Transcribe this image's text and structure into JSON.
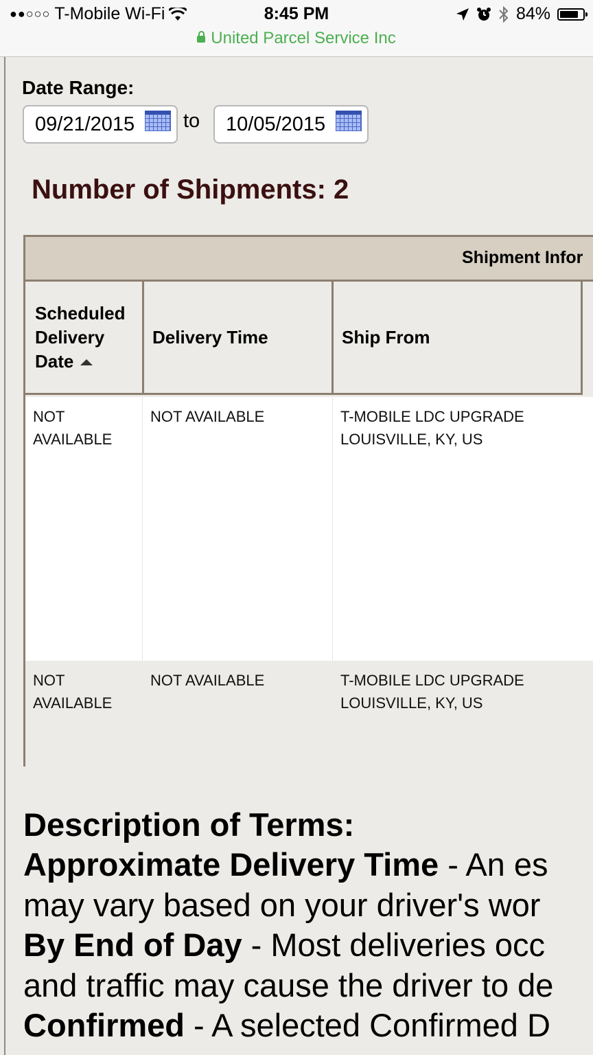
{
  "status_bar": {
    "signal": "●●○○○",
    "carrier": "T-Mobile Wi-Fi",
    "wifi_icon": "wifi-icon",
    "time": "8:45 PM",
    "battery_percent": "84%",
    "battery_level": 0.84,
    "url": "United Parcel Service Inc"
  },
  "filter": {
    "date_range_label": "Date Range:",
    "start_date": "09/21/2015",
    "to_label": "to",
    "end_date": "10/05/2015"
  },
  "summary": {
    "number_of_shipments": "Number of Shipments: 2"
  },
  "table": {
    "group_header": "Shipment Infor",
    "columns": [
      "Scheduled Delivery Date",
      "Delivery Time",
      "Ship From"
    ],
    "rows": [
      {
        "scheduled": "NOT AVAILABLE",
        "delivery_time": "NOT AVAILABLE",
        "ship_from_line1": "T-MOBILE LDC UPGRADE",
        "ship_from_line2": "LOUISVILLE, KY, US",
        "link": "1"
      },
      {
        "scheduled": "NOT AVAILABLE",
        "delivery_time": "NOT AVAILABLE",
        "ship_from_line1": "T-MOBILE LDC UPGRADE",
        "ship_from_line2": "LOUISVILLE, KY, US",
        "link": "1"
      }
    ]
  },
  "description": {
    "title": "Description of Terms:",
    "lines": [
      {
        "term": "Approximate Delivery Time",
        "text": " - An es"
      },
      {
        "term": "",
        "text": "may vary based on your driver's wor"
      },
      {
        "term": "By End of Day",
        "text": " - Most deliveries occ"
      },
      {
        "term": "",
        "text": "and traffic may cause the driver to de"
      },
      {
        "term": "Confirmed",
        "text": " - A selected Confirmed D"
      }
    ]
  }
}
